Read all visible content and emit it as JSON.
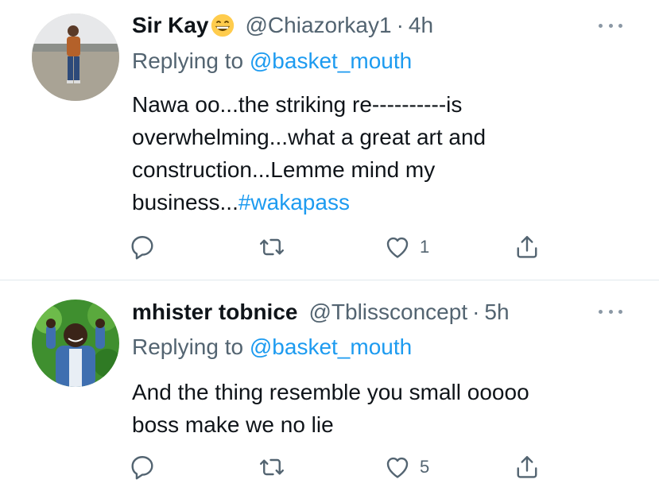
{
  "tweets": [
    {
      "display_name": "Sir Kay",
      "handle": "@Chiazorkay1",
      "separator": "·",
      "time": "4h",
      "replying_label": "Replying to ",
      "replying_handle": "@basket_mouth",
      "text_lines": [
        "Nawa oo...the striking re----------is",
        "overwhelming...what a great art and",
        "construction...Lemme mind my"
      ],
      "text_last_plain": "business...",
      "hashtag": "#wakapass",
      "reply_count": "",
      "retweet_count": "",
      "like_count": "1"
    },
    {
      "display_name": "mhister tobnice",
      "handle": "@Tblissconcept",
      "separator": "·",
      "time": "5h",
      "replying_label": "Replying to ",
      "replying_handle": "@basket_mouth",
      "text_lines": [
        "And the thing resemble you small ooooo",
        "boss make we no lie"
      ],
      "reply_count": "",
      "retweet_count": "",
      "like_count": "5"
    }
  ],
  "icons": {
    "avatar_1": "avatar-photo",
    "avatar_2": "avatar-photo",
    "emoji": "grinning-face-emoji",
    "more": "more-dots-icon",
    "reply": "reply-icon",
    "retweet": "retweet-icon",
    "like": "heart-icon",
    "share": "share-icon"
  },
  "colors": {
    "text": "#0f1419",
    "secondary": "#536471",
    "link": "#1d9bf0",
    "divider": "#e1e8ed",
    "background": "#ffffff"
  }
}
